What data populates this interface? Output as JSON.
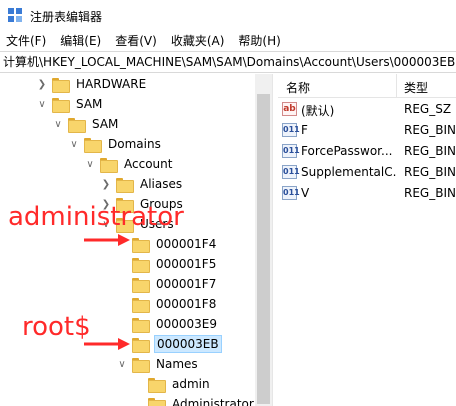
{
  "window": {
    "title": "注册表编辑器"
  },
  "menu": [
    "文件(F)",
    "编辑(E)",
    "查看(V)",
    "收藏夹(A)",
    "帮助(H)"
  ],
  "address": "计算机\\HKEY_LOCAL_MACHINE\\SAM\\SAM\\Domains\\Account\\Users\\000003EB",
  "tree": [
    {
      "label": "HARDWARE",
      "expander": "collapsed"
    },
    {
      "label": "SAM",
      "expander": "expanded"
    },
    {
      "label": "SAM",
      "expander": "expanded"
    },
    {
      "label": "Domains",
      "expander": "expanded"
    },
    {
      "label": "Account",
      "expander": "expanded"
    },
    {
      "label": "Aliases",
      "expander": "collapsed"
    },
    {
      "label": "Groups",
      "expander": "collapsed"
    },
    {
      "label": "Users",
      "expander": "expanded"
    },
    {
      "label": "000001F4",
      "expander": "none"
    },
    {
      "label": "000001F5",
      "expander": "none"
    },
    {
      "label": "000001F7",
      "expander": "none"
    },
    {
      "label": "000001F8",
      "expander": "none"
    },
    {
      "label": "000003E9",
      "expander": "none"
    },
    {
      "label": "000003EB",
      "expander": "none",
      "selected": true
    },
    {
      "label": "Names",
      "expander": "expanded"
    },
    {
      "label": "admin",
      "expander": "none"
    },
    {
      "label": "Administrator",
      "expander": "none"
    }
  ],
  "list": {
    "columns": [
      "名称",
      "类型"
    ],
    "rows": [
      {
        "name": "(默认)",
        "type": "REG_SZ",
        "icon": "string-value-icon"
      },
      {
        "name": "F",
        "type": "REG_BIN",
        "icon": "binary-value-icon"
      },
      {
        "name": "ForcePasswor...",
        "type": "REG_BIN",
        "icon": "binary-value-icon"
      },
      {
        "name": "SupplementalC...",
        "type": "REG_BIN",
        "icon": "binary-value-icon"
      },
      {
        "name": "V",
        "type": "REG_BIN",
        "icon": "binary-value-icon"
      }
    ]
  },
  "annotations": {
    "admin": "administrator",
    "root": "root$"
  },
  "colors": {
    "annotation": "#ff2a2a",
    "selection": "#cce8ff",
    "folder": "#f8d56b"
  }
}
